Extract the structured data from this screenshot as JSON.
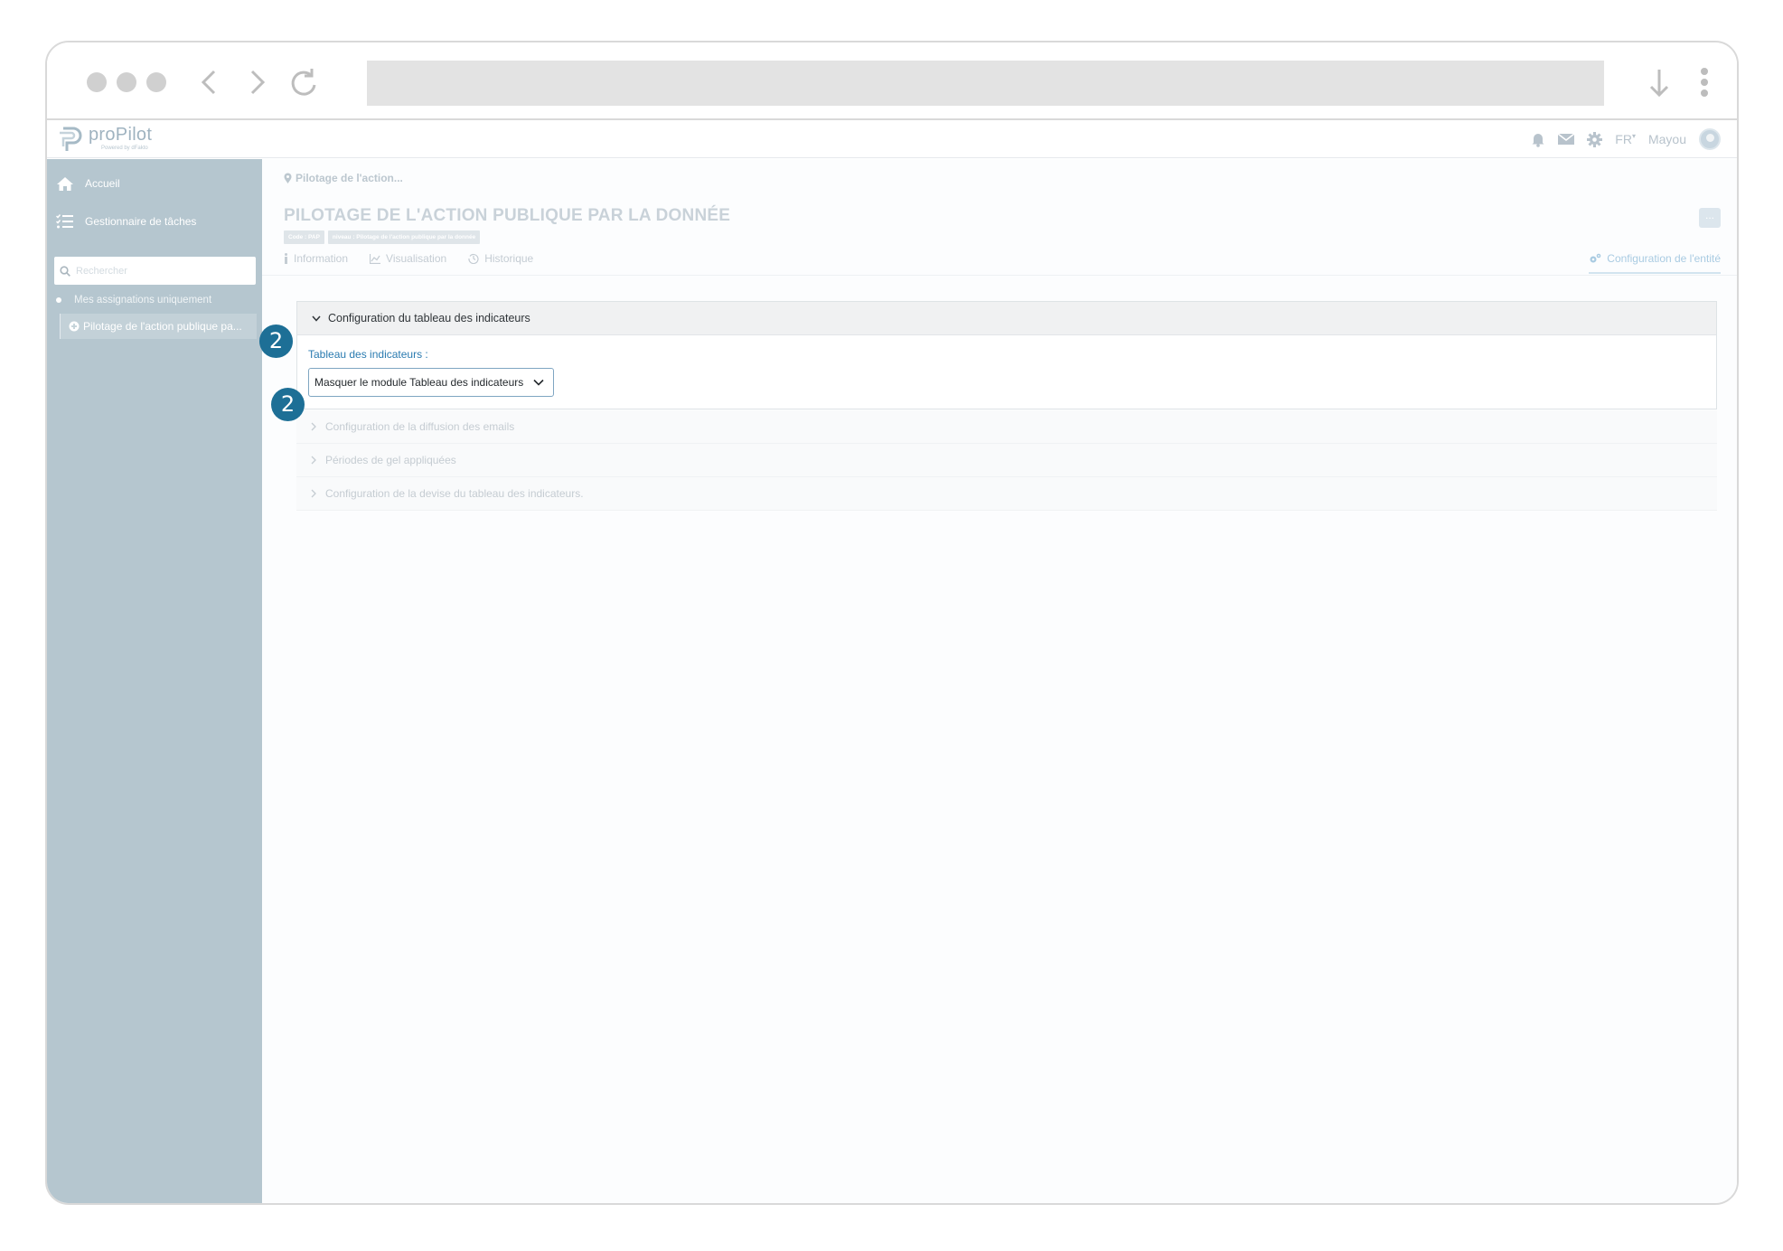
{
  "app": {
    "brand": "proPilot",
    "brand_sub": "Powered by dFakto"
  },
  "topbar": {
    "language": "FR",
    "user": "Mayou"
  },
  "sidebar": {
    "items": [
      {
        "label": "Accueil",
        "icon": "home-icon"
      },
      {
        "label": "Gestionnaire de tâches",
        "icon": "task-list-icon"
      }
    ],
    "search_placeholder": "Rechercher",
    "filter_label": "Mes assignations uniquement",
    "tree_item": "Pilotage de l'action publique pa..."
  },
  "page": {
    "breadcrumb": "Pilotage de l'action...",
    "title": "PILOTAGE DE L'ACTION PUBLIQUE PAR LA DONNÉE",
    "tags": [
      "Code : PAP",
      "niveau : Pilotage de l'action publique par la donnée"
    ],
    "more_label": "...",
    "tabs": [
      {
        "label": "Information",
        "icon": "info-icon"
      },
      {
        "label": "Visualisation",
        "icon": "chart-icon"
      },
      {
        "label": "Historique",
        "icon": "history-icon"
      }
    ],
    "active_tab": "Configuration de l'entité"
  },
  "config": {
    "open_section": "Configuration du tableau des indicateurs",
    "field_label": "Tableau des indicateurs :",
    "select_value": "Masquer le module Tableau des indicateurs",
    "collapsed_sections": [
      "Configuration de la diffusion des emails",
      "Périodes de gel appliquées",
      "Configuration de la devise du tableau des indicateurs."
    ]
  },
  "annotations": {
    "step_1": "2",
    "step_2": "2"
  },
  "colors": {
    "sidebar": "#b5c6cf",
    "badge": "#1d6f96",
    "link": "#2a7bb0"
  }
}
